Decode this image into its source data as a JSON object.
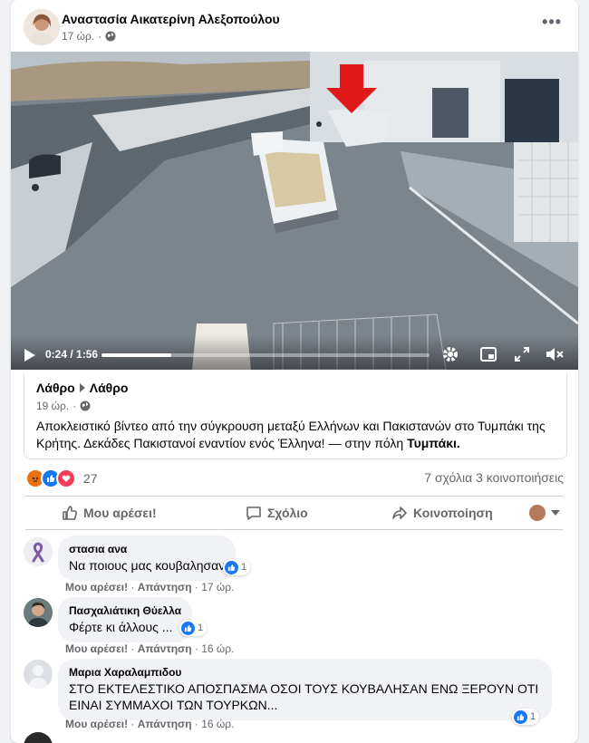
{
  "post": {
    "author": "Αναστασία Αικατερίνη Αλεξοπούλου",
    "time": "17 ώρ.",
    "more": "•••"
  },
  "video": {
    "time": "0:24 / 1:56",
    "progress": 0.213
  },
  "shared": {
    "source_a": "Λάθρο",
    "source_b": "Λάθρο",
    "time": "19 ώρ.",
    "text": "Αποκλειστικό βίντεο από την σύγκρουση μεταξύ Ελλήνων και Πακιστανών στο Τυμπάκι της Κρήτης. Δεκάδες Πακιστανοί εναντίον ενός Έλληνα! — στην πόλη ",
    "place": "Τυμπάκι."
  },
  "reactions": {
    "count": "27",
    "stats": "7 σχόλια  3 κοινοποιήσεις"
  },
  "actions": {
    "like": "Μου αρέσει!",
    "comment": "Σχόλιο",
    "share": "Κοινοποίηση"
  },
  "comments": [
    {
      "name": "στασια ανα",
      "text": "Να ποιους μας κουβαλησαν",
      "likes": "1",
      "like_label": "Μου αρέσει!",
      "reply_label": "Απάντηση",
      "time": "17 ώρ."
    },
    {
      "name": "Πασχαλιάτικη Θύελλα",
      "text": "Φέρτε κι άλλους ...",
      "likes": "1",
      "like_label": "Μου αρέσει!",
      "reply_label": "Απάντηση",
      "time": "16 ώρ."
    },
    {
      "name": "Μαρια Χαραλαμπιδου",
      "text": "ΣΤΟ ΕΚΤΕΛΕΣΤΙΚΟ ΑΠΟΣΠΑΣΜΑ ΟΣΟΙ ΤΟΥΣ ΚΟΥΒΑΛΗΣΑΝ ΕΝΩ ΞΕΡΟΥΝ ΟΤΙ ΕΙΝΑΙ ΣΥΜΜΑΧΟΙ ΤΩΝ ΤΟΥΡΚΩΝ...",
      "likes": "1",
      "like_label": "Μου αρέσει!",
      "reply_label": "Απάντηση",
      "time": "16 ώρ."
    }
  ],
  "separator": " · ",
  "colors": {
    "accent": "#1877f2",
    "muted": "#65676b",
    "angry": "#e9710f",
    "love": "#f33e58"
  }
}
